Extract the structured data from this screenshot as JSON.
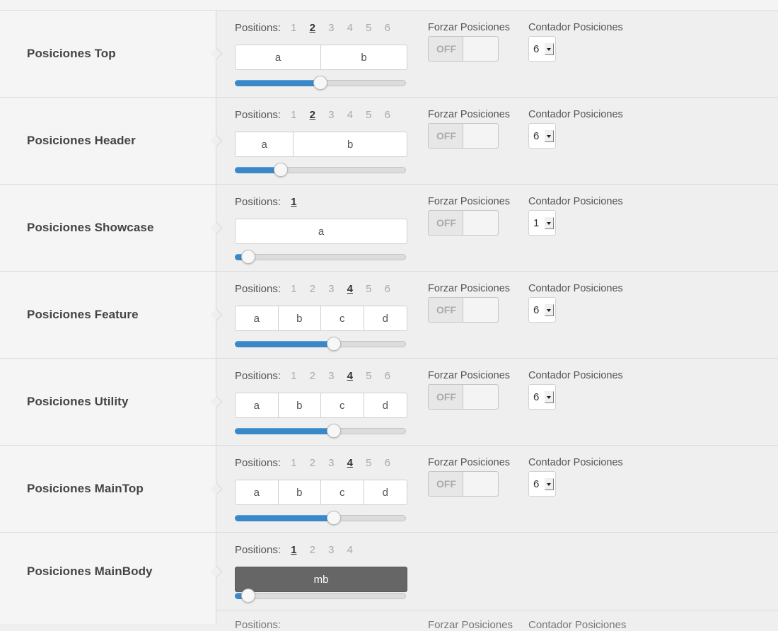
{
  "positions_label": "Positions:",
  "forzar_label": "Forzar Posiciones",
  "contador_label": "Contador Posiciones",
  "toggle_off_label": "OFF",
  "rows": [
    {
      "title": "Posiciones Top",
      "numbers": [
        "1",
        "2",
        "3",
        "4",
        "5",
        "6"
      ],
      "selected": "2",
      "cells": [
        "a",
        "b"
      ],
      "slider_fraction": 0.5,
      "counter": "6"
    },
    {
      "title": "Posiciones Header",
      "numbers": [
        "1",
        "2",
        "3",
        "4",
        "5",
        "6"
      ],
      "selected": "2",
      "cells": [
        "a",
        "b"
      ],
      "slider_fraction": 0.27,
      "counter": "6"
    },
    {
      "title": "Posiciones Showcase",
      "numbers": [
        "1"
      ],
      "selected": "1",
      "cells": [
        "a"
      ],
      "slider_fraction": 0.08,
      "counter": "1"
    },
    {
      "title": "Posiciones Feature",
      "numbers": [
        "1",
        "2",
        "3",
        "4",
        "5",
        "6"
      ],
      "selected": "4",
      "cells": [
        "a",
        "b",
        "c",
        "d"
      ],
      "slider_fraction": 0.58,
      "counter": "6"
    },
    {
      "title": "Posiciones Utility",
      "numbers": [
        "1",
        "2",
        "3",
        "4",
        "5",
        "6"
      ],
      "selected": "4",
      "cells": [
        "a",
        "b",
        "c",
        "d"
      ],
      "slider_fraction": 0.58,
      "counter": "6"
    },
    {
      "title": "Posiciones MainTop",
      "numbers": [
        "1",
        "2",
        "3",
        "4",
        "5",
        "6"
      ],
      "selected": "4",
      "cells": [
        "a",
        "b",
        "c",
        "d"
      ],
      "slider_fraction": 0.58,
      "counter": "6"
    },
    {
      "title": "Posiciones MainBody",
      "numbers": [
        "1",
        "2",
        "3",
        "4"
      ],
      "selected": "1",
      "cells": [
        "mb"
      ],
      "slider_fraction": 0.08,
      "dark": true
    }
  ],
  "colors": {
    "slider_fill": "#3a88c8",
    "mainbody_box": "#666666"
  }
}
